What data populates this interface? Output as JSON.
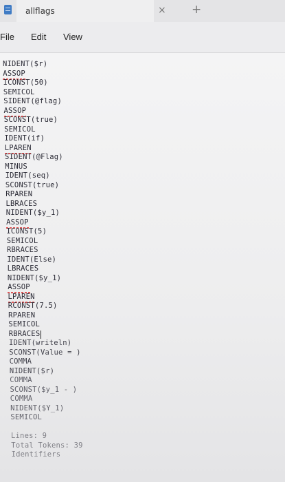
{
  "window": {
    "tab_title": "allflags",
    "close_glyph": "×",
    "new_tab_glyph": "+"
  },
  "menu": {
    "file": "File",
    "edit": "Edit",
    "view": "View"
  },
  "editor": {
    "lines": [
      "NIDENT($r)",
      "ASSOP",
      "ICONST(50)",
      "SEMICOL",
      "SIDENT(@flag)",
      "ASSOP",
      "SCONST(true)",
      "SEMICOL",
      "IDENT(if)",
      "LPAREN",
      "SIDENT(@Flag)",
      "MINUS",
      "IDENT(seq)",
      "SCONST(true)",
      "RPAREN",
      "LBRACES",
      "NIDENT($y_1)",
      "ASSOP",
      "ICONST(5)",
      "SEMICOL",
      "RBRACES",
      "IDENT(Else)",
      "LBRACES",
      "NIDENT($y_1)",
      "ASSOP",
      "LPAREN",
      "RCONST(7.5)",
      "RPAREN",
      "SEMICOL",
      "RBRACES",
      "IDENT(writeln)",
      "SCONST(Value = )",
      "COMMA",
      "NIDENT($r)",
      "COMMA",
      "SCONST($y_1 - )",
      "COMMA",
      "NIDENT($Y_1)",
      "SEMICOL",
      "",
      "Lines: 9",
      "Total Tokens: 39",
      "Identifiers"
    ]
  }
}
